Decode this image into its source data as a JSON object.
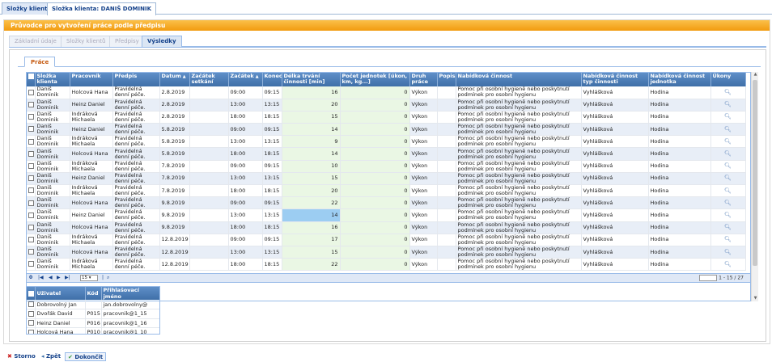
{
  "top_tabs": [
    "Složky klientů",
    "Složka klienta: DANIŠ DOMINIK"
  ],
  "wizard": {
    "header": "Průvodce pro vytvoření práce podle předpisu",
    "tabs": [
      "Základní údaje",
      "Složky klientů",
      "Předpisy",
      "Výsledky"
    ],
    "inner_tab": "Práce"
  },
  "grid": {
    "columns": [
      "Složka klienta",
      "Pracovník",
      "Předpis",
      "Datum",
      "Začátek setkání",
      "Začátek",
      "Konec",
      "Délka trvání činnosti [min]",
      "Počet jednotek [úkon, km, kg...]",
      "Druh práce",
      "Popis",
      "Nabídková činnost",
      "Nabídková činnost typ činnosti",
      "Nabídková činnost jednotka",
      "Úkony"
    ],
    "rows": [
      [
        "Daniš Dominik",
        "Holcová Hana",
        "Pravidelná denní péče.",
        "2.8.2019",
        "",
        "09:00",
        "09:15",
        "16",
        "0",
        "Výkon",
        "",
        "Pomoc při osobní hygieně nebo poskytnutí podmínek pro osobní hygienu",
        "Vyhlášková",
        "Hodina"
      ],
      [
        "Daniš Dominik",
        "Heinz Daniel",
        "Pravidelná denní péče.",
        "2.8.2019",
        "",
        "13:00",
        "13:15",
        "20",
        "0",
        "Výkon",
        "",
        "Pomoc při osobní hygieně nebo poskytnutí podmínek pro osobní hygienu",
        "Vyhlášková",
        "Hodina"
      ],
      [
        "Daniš Dominik",
        "Indráková Michaela",
        "Pravidelná denní péče.",
        "2.8.2019",
        "",
        "18:00",
        "18:15",
        "15",
        "0",
        "Výkon",
        "",
        "Pomoc při osobní hygieně nebo poskytnutí podmínek pro osobní hygienu",
        "Vyhlášková",
        "Hodina"
      ],
      [
        "Daniš Dominik",
        "Heinz Daniel",
        "Pravidelná denní péče.",
        "5.8.2019",
        "",
        "09:00",
        "09:15",
        "14",
        "0",
        "Výkon",
        "",
        "Pomoc při osobní hygieně nebo poskytnutí podmínek pro osobní hygienu",
        "Vyhlášková",
        "Hodina"
      ],
      [
        "Daniš Dominik",
        "Indráková Michaela",
        "Pravidelná denní péče.",
        "5.8.2019",
        "",
        "13:00",
        "13:15",
        "9",
        "0",
        "Výkon",
        "",
        "Pomoc při osobní hygieně nebo poskytnutí podmínek pro osobní hygienu",
        "Vyhlášková",
        "Hodina"
      ],
      [
        "Daniš Dominik",
        "Holcová Hana",
        "Pravidelná denní péče.",
        "5.8.2019",
        "",
        "18:00",
        "18:15",
        "14",
        "0",
        "Výkon",
        "",
        "Pomoc při osobní hygieně nebo poskytnutí podmínek pro osobní hygienu",
        "Vyhlášková",
        "Hodina"
      ],
      [
        "Daniš Dominik",
        "Indráková Michaela",
        "Pravidelná denní péče.",
        "7.8.2019",
        "",
        "09:00",
        "09:15",
        "10",
        "0",
        "Výkon",
        "",
        "Pomoc při osobní hygieně nebo poskytnutí podmínek pro osobní hygienu",
        "Vyhlášková",
        "Hodina"
      ],
      [
        "Daniš Dominik",
        "Heinz Daniel",
        "Pravidelná denní péče.",
        "7.8.2019",
        "",
        "13:00",
        "13:15",
        "15",
        "0",
        "Výkon",
        "",
        "Pomoc při osobní hygieně nebo poskytnutí podmínek pro osobní hygienu",
        "Vyhlášková",
        "Hodina"
      ],
      [
        "Daniš Dominik",
        "Indráková Michaela",
        "Pravidelná denní péče.",
        "7.8.2019",
        "",
        "18:00",
        "18:15",
        "20",
        "0",
        "Výkon",
        "",
        "Pomoc při osobní hygieně nebo poskytnutí podmínek pro osobní hygienu",
        "Vyhlášková",
        "Hodina"
      ],
      [
        "Daniš Dominik",
        "Holcová Hana",
        "Pravidelná denní péče.",
        "9.8.2019",
        "",
        "09:00",
        "09:15",
        "22",
        "0",
        "Výkon",
        "",
        "Pomoc při osobní hygieně nebo poskytnutí podmínek pro osobní hygienu",
        "Vyhlášková",
        "Hodina"
      ],
      [
        "Daniš Dominik",
        "Heinz Daniel",
        "Pravidelná denní péče.",
        "9.8.2019",
        "",
        "13:00",
        "13:15",
        "14",
        "0",
        "Výkon",
        "",
        "Pomoc při osobní hygieně nebo poskytnutí podmínek pro osobní hygienu",
        "Vyhlášková",
        "Hodina"
      ],
      [
        "Daniš Dominik",
        "Holcová Hana",
        "Pravidelná denní péče.",
        "9.8.2019",
        "",
        "18:00",
        "18:15",
        "16",
        "0",
        "Výkon",
        "",
        "Pomoc při osobní hygieně nebo poskytnutí podmínek pro osobní hygienu",
        "Vyhlášková",
        "Hodina"
      ],
      [
        "Daniš Dominik",
        "Indráková Michaela",
        "Pravidelná denní péče.",
        "12.8.2019",
        "",
        "09:00",
        "09:15",
        "17",
        "0",
        "Výkon",
        "",
        "Pomoc při osobní hygieně nebo poskytnutí podmínek pro osobní hygienu",
        "Vyhlášková",
        "Hodina"
      ],
      [
        "Daniš Dominik",
        "Holcová Hana",
        "Pravidelná denní péče.",
        "12.8.2019",
        "",
        "13:00",
        "13:15",
        "15",
        "0",
        "Výkon",
        "",
        "Pomoc při osobní hygieně nebo poskytnutí podmínek pro osobní hygienu",
        "Vyhlášková",
        "Hodina"
      ],
      [
        "Daniš Dominik",
        "Indráková Michaela",
        "Pravidelná denní péče.",
        "12.8.2019",
        "",
        "18:00",
        "18:15",
        "22",
        "0",
        "Výkon",
        "",
        "Pomoc při osobní hygieně nebo poskytnutí podmínek pro osobní hygienu",
        "Vyhlášková",
        "Hodina"
      ]
    ]
  },
  "pager": {
    "count": "0",
    "page_size": "15",
    "info": "1 - 15 / 27"
  },
  "users": {
    "columns": [
      "Uživatel",
      "Kód",
      "Přihlašovací jméno"
    ],
    "rows": [
      [
        "Dobrovolný Jan",
        "",
        "jan.dobrovolny@"
      ],
      [
        "Dvořák David",
        "P015",
        "pracovnik@1_15"
      ],
      [
        "Heinz Daniel",
        "P016",
        "pracovnik@1_16"
      ],
      [
        "Holcová Hana",
        "P010",
        "pracovnik@1_10"
      ]
    ]
  },
  "buttons": {
    "cancel": "Storno",
    "back": "Zpět",
    "finish": "Dokončit"
  }
}
